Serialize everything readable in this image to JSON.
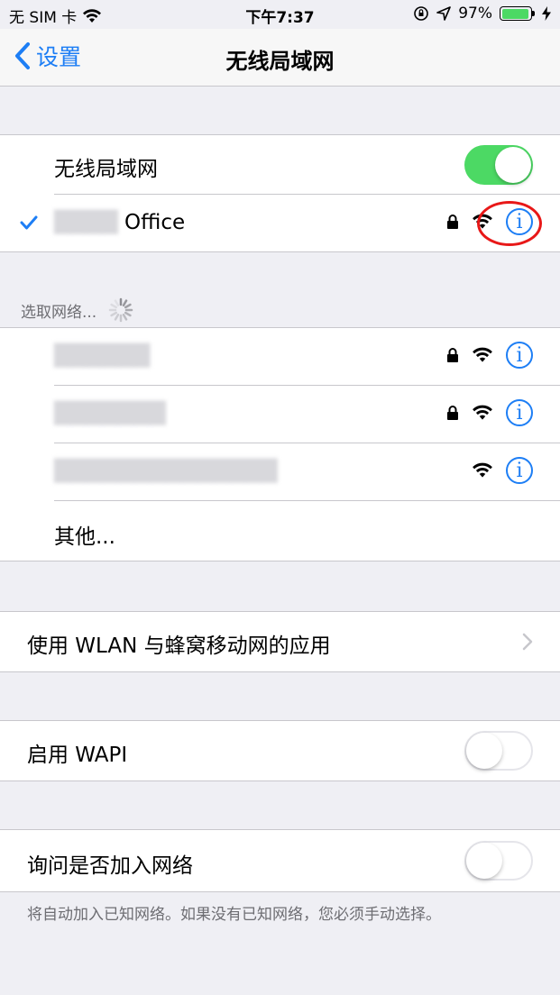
{
  "status_bar": {
    "carrier": "无 SIM 卡",
    "time": "下午7:37",
    "battery_percent": "97%",
    "battery_level": 0.97
  },
  "nav": {
    "back_label": "设置",
    "title": "无线局域网"
  },
  "wifi_toggle": {
    "label": "无线局域网",
    "on": true
  },
  "connected_network": {
    "name_suffix": "Office",
    "locked": true
  },
  "choose_network": {
    "header": "选取网络...",
    "networks": [
      {
        "name": "",
        "locked": true
      },
      {
        "name": "",
        "locked": true
      },
      {
        "name": "",
        "locked": false
      }
    ],
    "other_label": "其他..."
  },
  "apps_row": {
    "label": "使用 WLAN 与蜂窝移动网的应用"
  },
  "wapi_row": {
    "label": "启用 WAPI",
    "on": false
  },
  "ask_join_row": {
    "label": "询问是否加入网络",
    "on": false
  },
  "ask_join_note": "将自动加入已知网络。如果没有已知网络，您必须手动选择。",
  "colors": {
    "accent": "#1d7ef5",
    "toggle_on": "#4cd964",
    "highlight": "#e81818"
  }
}
